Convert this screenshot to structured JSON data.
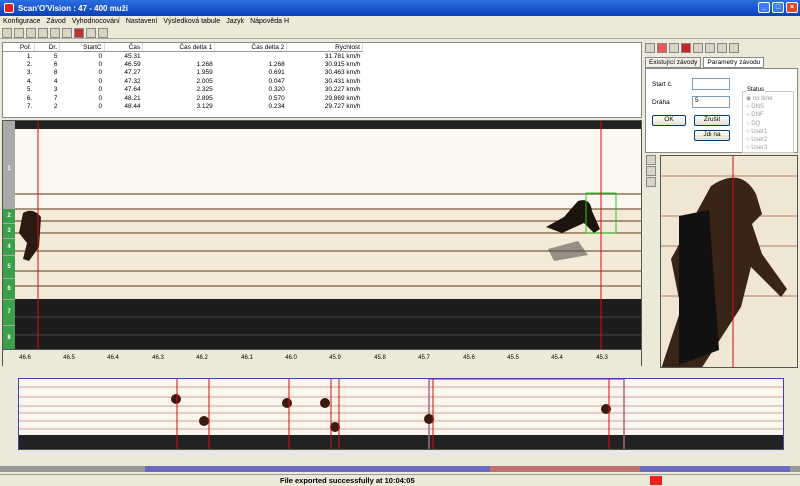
{
  "window": {
    "title": "Scan'O'Vision : 47 - 400 muži"
  },
  "menu": [
    "Konfigurace",
    "Závod",
    "Vyhodnocování",
    "Nastavení",
    "Výsledková tabule",
    "Jazyk",
    "Nápověda H"
  ],
  "results": {
    "headers": [
      "Poř.",
      "Dr.",
      "StartC",
      "Čas",
      "Čas delta 1",
      "Čas delta 2",
      "Rychlost"
    ],
    "rows": [
      [
        "1.",
        "5",
        "0",
        "45.31",
        "",
        "",
        "31.781 km/h"
      ],
      [
        "2.",
        "6",
        "0",
        "46.59",
        "1.268",
        "1.268",
        "30.915 km/h"
      ],
      [
        "3.",
        "8",
        "0",
        "47.27",
        "1.959",
        "0.691",
        "30.463 km/h"
      ],
      [
        "4.",
        "4",
        "0",
        "47.32",
        "2.005",
        "0.047",
        "30.431 km/h"
      ],
      [
        "5.",
        "3",
        "0",
        "47.64",
        "2.325",
        "0.320",
        "30.227 km/h"
      ],
      [
        "6.",
        "7",
        "0",
        "48.21",
        "2.895",
        "0.570",
        "29.869 km/h"
      ],
      [
        "7.",
        "2",
        "0",
        "48.44",
        "3.129",
        "0.234",
        "29.727 km/h"
      ]
    ]
  },
  "panel": {
    "tabs": [
      "Existující závody",
      "Parametry závodu"
    ],
    "start_label": "Start č.",
    "start_value": "",
    "lane_label": "Dráha",
    "lane_value": "5",
    "ok": "OK",
    "cancel": "Zrušit",
    "goto": "Jdi na",
    "status_title": "Status",
    "status_options": [
      "no time",
      "DNS",
      "DNF",
      "DQ",
      "User1",
      "User2",
      "User3"
    ]
  },
  "lanes": [
    "1",
    "2",
    "3",
    "4",
    "5",
    "6",
    "7",
    "8"
  ],
  "time_axis": [
    "46.6",
    "46.5",
    "46.4",
    "46.3",
    "46.2",
    "46.1",
    "46.0",
    "45.9",
    "45.8",
    "45.7",
    "45.6",
    "45.5",
    "45.4",
    "45.3"
  ],
  "statusbar": {
    "message": "File exported successfully at 10:04:05"
  },
  "colors": {
    "titlebar": "#0a3fb8",
    "finish_line": "#d01010",
    "lane_label": "#3aa04a",
    "track": "#f4ead8"
  }
}
